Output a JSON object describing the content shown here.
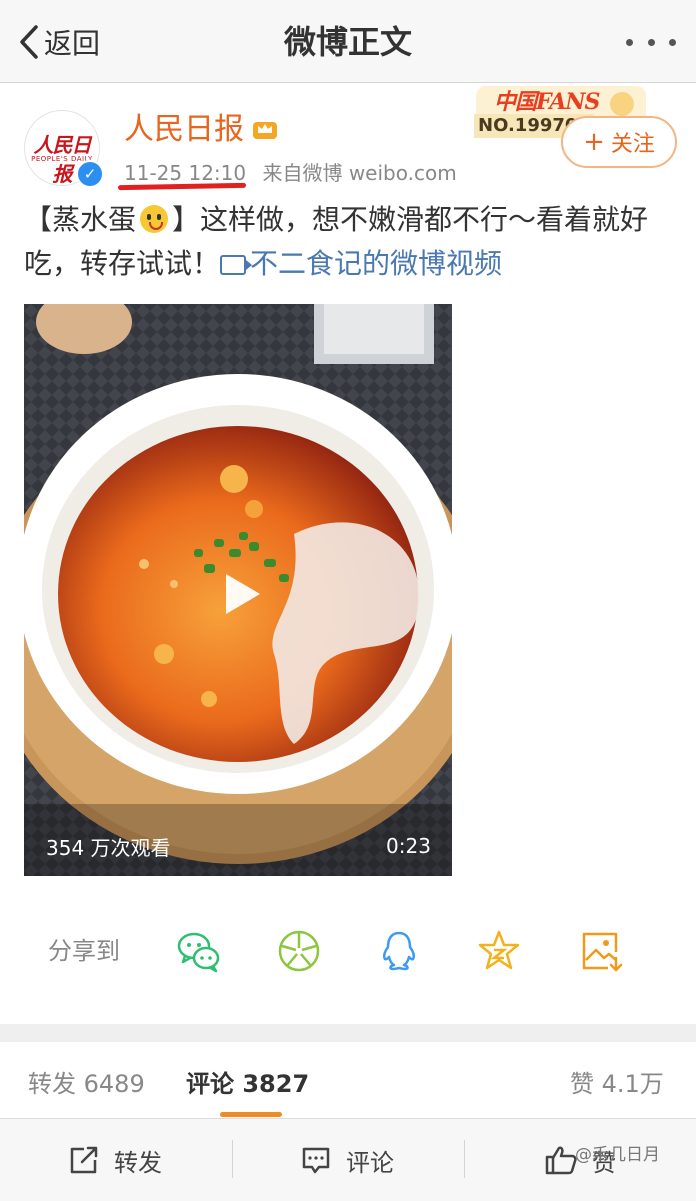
{
  "nav": {
    "back_label": "返回",
    "title": "微博正文"
  },
  "user": {
    "name": "人民日报",
    "avatar_logo": "人民日报",
    "avatar_sub": "PEOPLE'S DAILY",
    "time": "11-25 12:10",
    "source": "来自微博 weibo.com",
    "fans_badge_title": "中国FANS",
    "fans_badge_no": "NO.199707",
    "follow_label": "关注"
  },
  "post": {
    "text_part1": "【蒸水蛋",
    "text_part2": "】这样做，想不嫩滑都不行～看着就好吃，转存试试！",
    "video_link": "不二食记的微博视频"
  },
  "video": {
    "views": "354 万次观看",
    "duration": "0:23"
  },
  "share": {
    "label": "分享到",
    "targets": [
      "wechat-icon",
      "moments-icon",
      "qq-icon",
      "qzone-icon",
      "save-image-icon"
    ]
  },
  "tabs": {
    "repost_label": "转发",
    "repost_count": "6489",
    "comment_label": "评论",
    "comment_count": "3827",
    "like_label": "赞",
    "like_count": "4.1万"
  },
  "actions": {
    "repost": "转发",
    "comment": "评论",
    "like": "赞"
  },
  "watermark": "@禾几日月",
  "colors": {
    "accent_orange": "#e8651b",
    "link_blue": "#4a78b0",
    "verified_blue": "#2b8ff2",
    "share_green": "#2fbf71"
  }
}
